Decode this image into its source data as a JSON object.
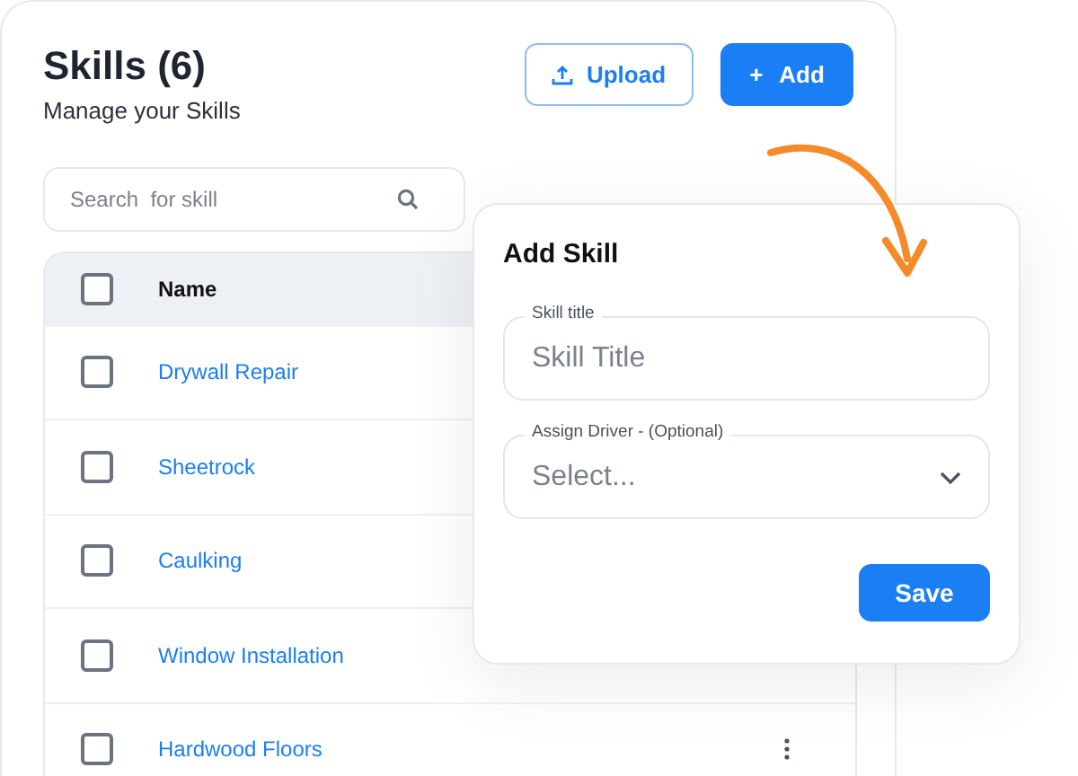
{
  "header": {
    "title": "Skills (6)",
    "subtitle": "Manage your Skills"
  },
  "buttons": {
    "upload": "Upload",
    "add": "Add",
    "add_icon": "+"
  },
  "search": {
    "placeholder": "Search  for skill"
  },
  "table": {
    "columns": [
      "Name"
    ],
    "all_checked": false,
    "rows": [
      {
        "name": "Drywall Repair",
        "checked": false
      },
      {
        "name": "Sheetrock",
        "checked": false
      },
      {
        "name": "Caulking",
        "checked": false
      },
      {
        "name": "Window Installation",
        "checked": false
      },
      {
        "name": "Hardwood Floors",
        "checked": false
      }
    ]
  },
  "dialog": {
    "title": "Add Skill",
    "fields": [
      {
        "kind": "text",
        "label": "Skill title",
        "placeholder": "Skill Title"
      },
      {
        "kind": "select",
        "label": "Assign Driver - (Optional)",
        "placeholder": "Select..."
      }
    ],
    "save": "Save"
  }
}
